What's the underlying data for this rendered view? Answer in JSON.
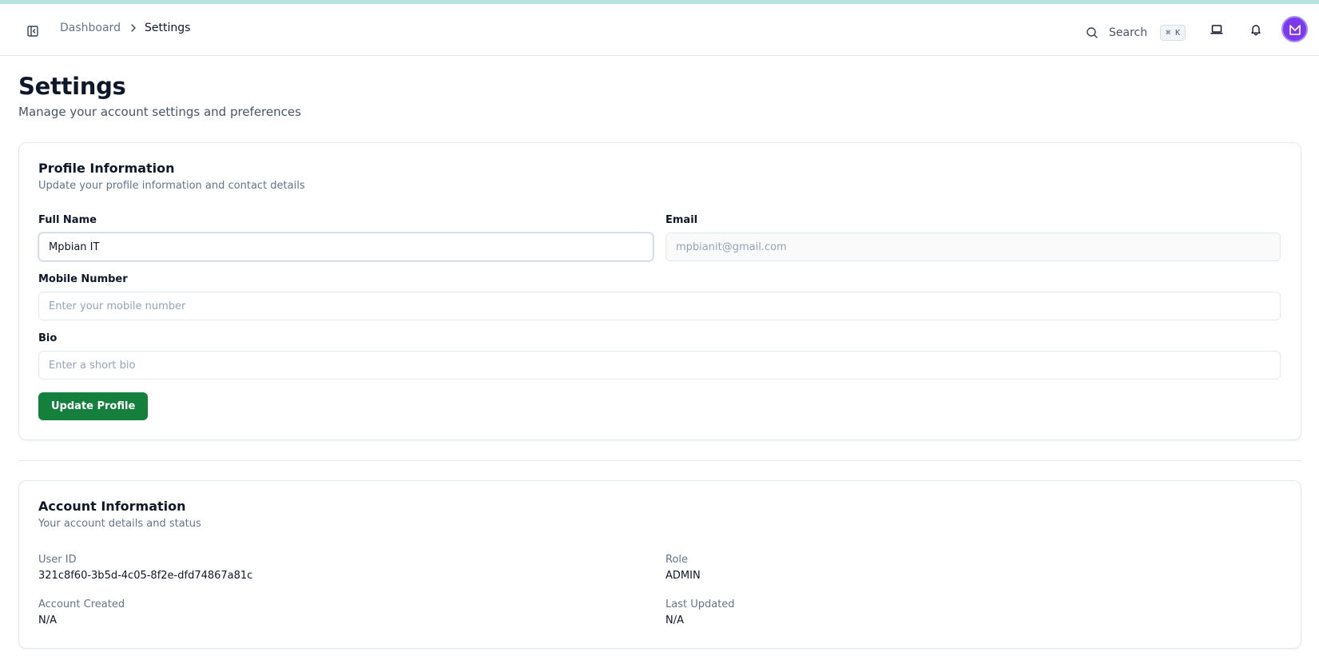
{
  "header": {
    "sidebar_toggle_icon": "sidebar-toggle-icon",
    "breadcrumb": {
      "parent": "Dashboard",
      "current": "Settings"
    },
    "search": {
      "label": "Search",
      "shortcut": "⌘ K"
    },
    "icons": [
      "search-icon",
      "laptop-icon",
      "bell-icon"
    ],
    "avatar_icon": "logo-m-icon"
  },
  "page": {
    "title": "Settings",
    "subtitle": "Manage your account settings and preferences"
  },
  "profile": {
    "title": "Profile Information",
    "description": "Update your profile information and contact details",
    "full_name": {
      "label": "Full Name",
      "value": "Mpbian IT"
    },
    "email": {
      "label": "Email",
      "placeholder": "mpbianit@gmail.com"
    },
    "mobile": {
      "label": "Mobile Number",
      "placeholder": "Enter your mobile number"
    },
    "bio": {
      "label": "Bio",
      "placeholder": "Enter a short bio"
    },
    "submit_label": "Update Profile"
  },
  "account": {
    "title": "Account Information",
    "description": "Your account details and status",
    "user_id": {
      "label": "User ID",
      "value": "321c8f60-3b5d-4c05-8f2e-dfd74867a81c"
    },
    "role": {
      "label": "Role",
      "value": "ADMIN"
    },
    "created": {
      "label": "Account Created",
      "value": "N/A"
    },
    "updated": {
      "label": "Last Updated",
      "value": "N/A"
    }
  },
  "colors": {
    "accent_bar": "#b7e3df",
    "primary_button": "#15803d",
    "avatar": "#7c3aed"
  }
}
